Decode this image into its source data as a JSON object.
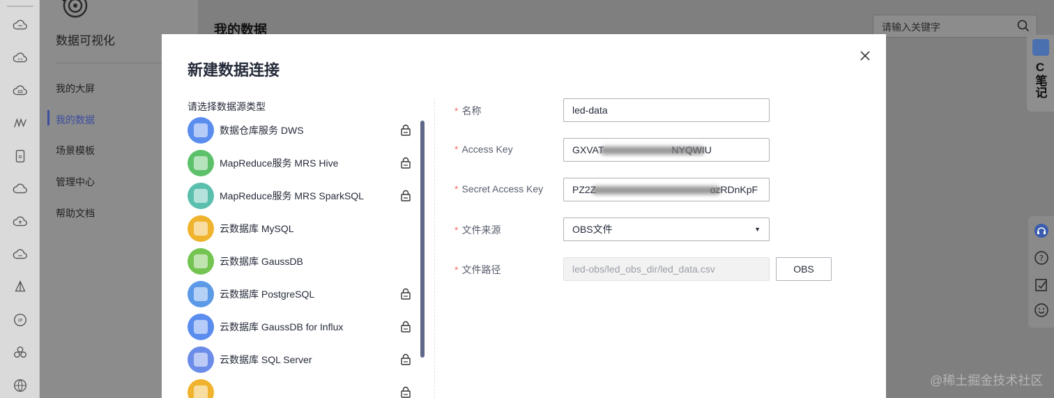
{
  "sidebar": {
    "app_title": "数据可视化",
    "items": [
      {
        "label": "我的大屏"
      },
      {
        "label": "我的数据"
      },
      {
        "label": "场景模板"
      },
      {
        "label": "管理中心"
      },
      {
        "label": "帮助文档"
      }
    ],
    "active_item": "我的数据"
  },
  "header": {
    "title": "我的数据",
    "search_placeholder": "请输入关键字"
  },
  "note_widget": {
    "letter": "C",
    "text": "笔记"
  },
  "watermark": "@稀土掘金技术社区",
  "modal": {
    "title": "新建数据连接",
    "source_prompt": "请选择数据源类型",
    "sources": [
      {
        "label": "数据仓库服务 DWS",
        "color": "#5b8def",
        "locked": true
      },
      {
        "label": "MapReduce服务 MRS Hive",
        "color": "#5cc16a",
        "locked": true
      },
      {
        "label": "MapReduce服务 MRS SparkSQL",
        "color": "#5bbfae",
        "locked": true
      },
      {
        "label": "云数据库 MySQL",
        "color": "#f0b32e",
        "locked": false
      },
      {
        "label": "云数据库 GaussDB",
        "color": "#73c451",
        "locked": false
      },
      {
        "label": "云数据库 PostgreSQL",
        "color": "#5c9ae8",
        "locked": true
      },
      {
        "label": "云数据库 GaussDB for Influx",
        "color": "#5b8def",
        "locked": true
      },
      {
        "label": "云数据库 SQL Server",
        "color": "#6b8ce8",
        "locked": true
      },
      {
        "label": "",
        "color": "#f0b32e",
        "locked": true
      }
    ],
    "form": {
      "name": {
        "label": "名称",
        "value": "led-data"
      },
      "access_key": {
        "label": "Access Key",
        "value": "GXVAT                         NYQWIU"
      },
      "secret_key": {
        "label": "Secret Access Key",
        "value": "PZ2Z                                          ozRDnKpF"
      },
      "file_source": {
        "label": "文件来源",
        "value": "OBS文件",
        "options": [
          "OBS文件"
        ]
      },
      "file_path": {
        "label": "文件路径",
        "value": "led-obs/led_obs_dir/led_data.csv",
        "button": "OBS"
      }
    }
  }
}
